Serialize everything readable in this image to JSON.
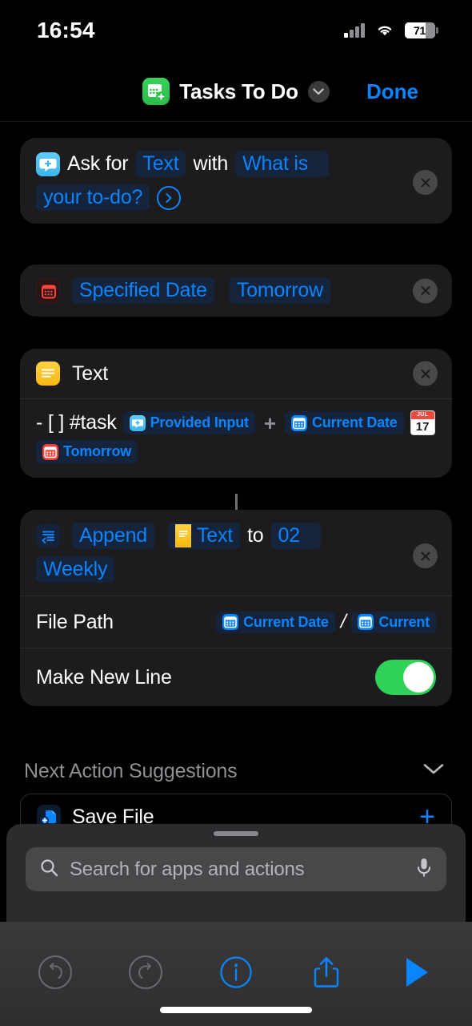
{
  "status_bar": {
    "time": "16:54",
    "battery_percent": "71",
    "signal_icon": "cellular-bars-icon",
    "wifi_icon": "wifi-icon",
    "battery_icon": "battery-icon"
  },
  "nav_bar": {
    "shortcut_icon": "calendar-add-icon",
    "title": "Tasks To Do",
    "chevron_icon": "chevron-down-icon",
    "done_label": "Done",
    "accent_color": "#0a84ff"
  },
  "actions": [
    {
      "id": "ask-for-input",
      "icon": "ask-for-input-icon",
      "words": {
        "w1": "Ask for",
        "w2": "with"
      },
      "tokens": {
        "type": "Text",
        "prompt_a": "What is",
        "prompt_b": "your to-do?"
      },
      "expand_icon": "chevron-right-circle-icon",
      "close_icon": "close-icon"
    },
    {
      "id": "date",
      "icon": "calendar-red-icon",
      "tokens": {
        "mode": "Specified Date",
        "value": "Tomorrow"
      },
      "close_icon": "close-icon"
    },
    {
      "id": "text",
      "icon": "text-icon",
      "title": "Text",
      "close_icon": "close-icon",
      "body": {
        "prefix": "- [ ] #task",
        "token_provided_input": "Provided Input",
        "plus_glyph": "+",
        "token_current_date": "Current Date",
        "emoji_calendar": {
          "month": "JUL",
          "day": "17"
        },
        "token_tomorrow": "Tomorrow"
      }
    },
    {
      "id": "append-to-file",
      "icon": "append-to-file-icon",
      "tokens": {
        "verb": "Append",
        "subject": "Text",
        "target_a": "02",
        "target_b": "Weekly"
      },
      "words": {
        "to": "to"
      },
      "close_icon": "close-icon",
      "params": [
        {
          "label": "File Path",
          "value_tokens": [
            "Current Date",
            "Current"
          ],
          "separator": "/"
        },
        {
          "label": "Make New Line",
          "toggle": "on",
          "toggle_color": "#30d158"
        }
      ]
    }
  ],
  "suggestions": {
    "header": "Next Action Suggestions",
    "collapse_icon": "chevron-down-icon",
    "items": [
      {
        "label": "Save File",
        "icon": "save-file-icon",
        "add_icon": "plus-icon"
      }
    ]
  },
  "search_sheet": {
    "grabber": "sheet-grabber",
    "search_icon": "search-icon",
    "placeholder": "Search for apps and actions",
    "value": "",
    "mic_icon": "microphone-icon"
  },
  "toolbar": {
    "undo_icon": "undo-icon",
    "redo_icon": "redo-icon",
    "info_icon": "info-circle-icon",
    "share_icon": "share-icon",
    "run_icon": "play-icon",
    "undo_enabled": "false",
    "redo_enabled": "false"
  }
}
